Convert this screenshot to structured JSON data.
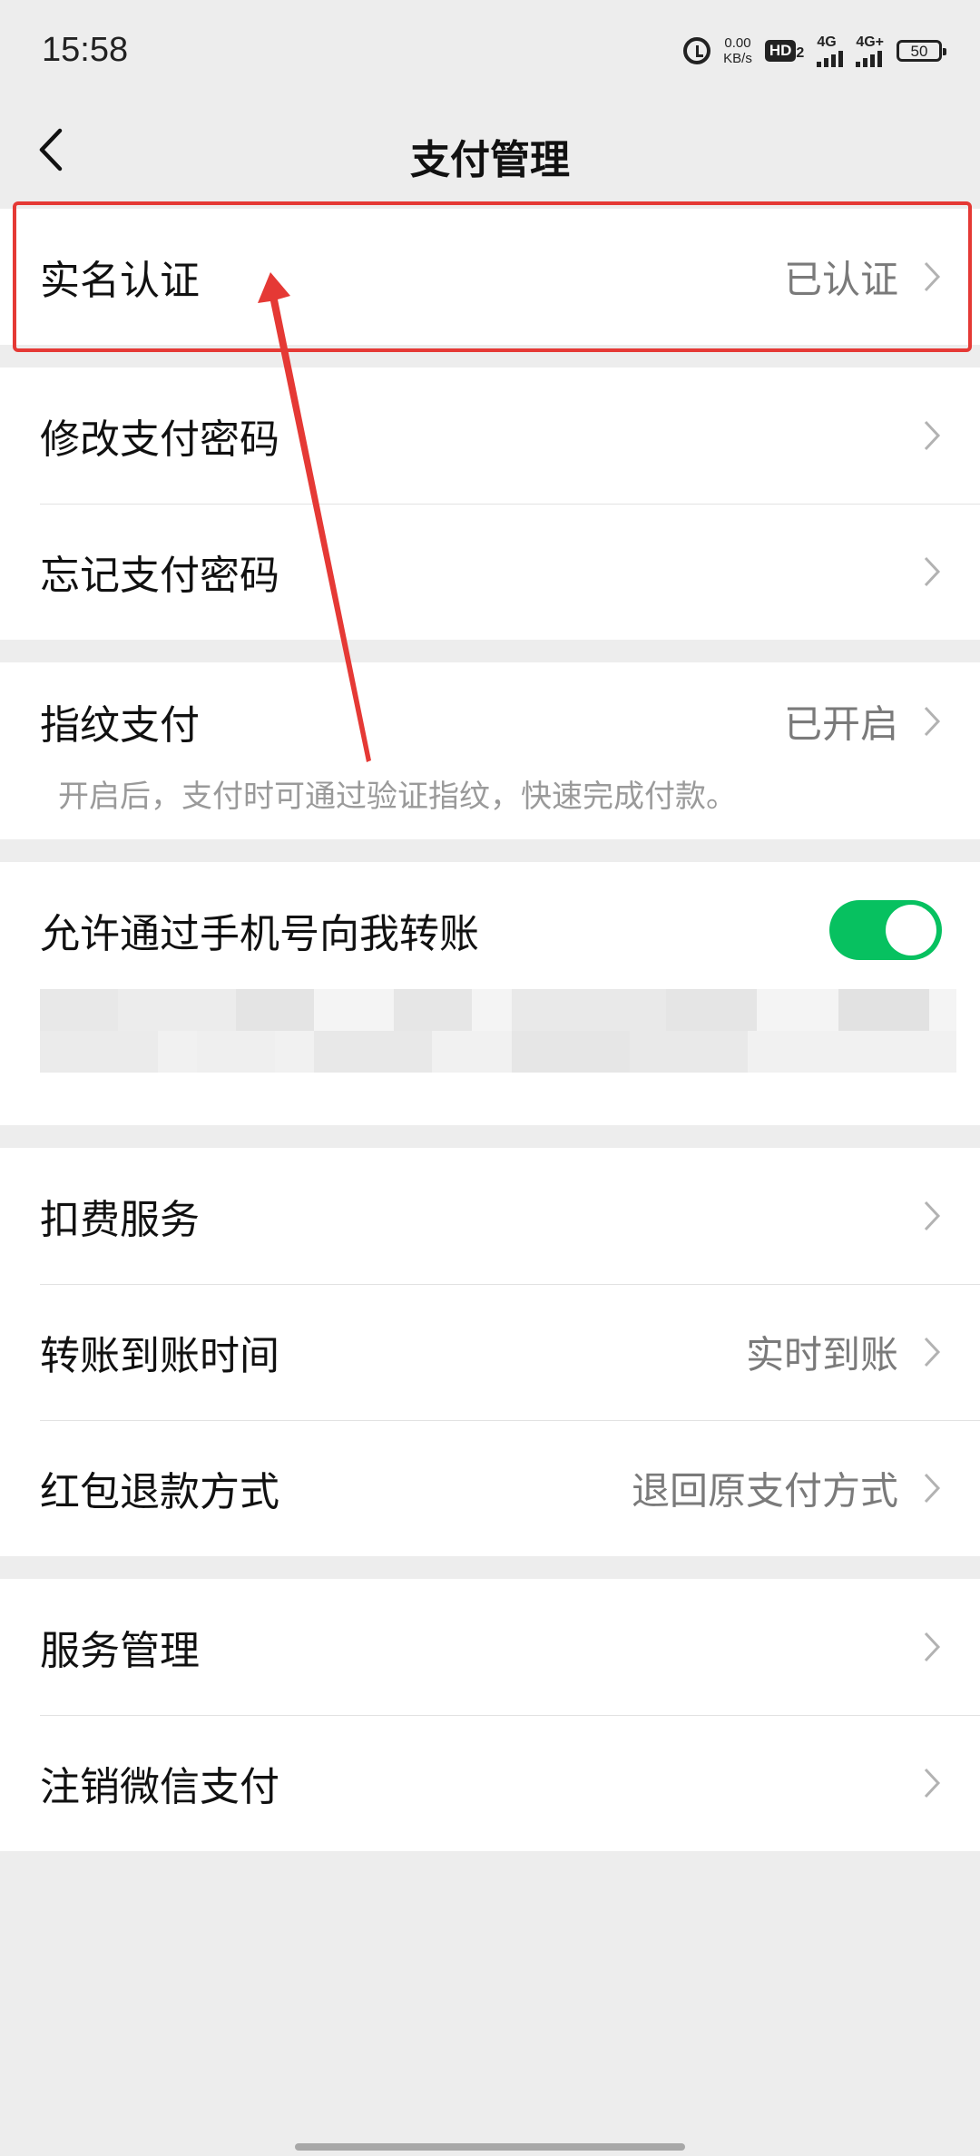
{
  "status_bar": {
    "time": "15:58",
    "net_speed_value": "0.00",
    "net_speed_unit": "KB/s",
    "hd_label": "HD",
    "hd_sub": "2",
    "sim1_label": "4G",
    "sim2_label": "4G+",
    "battery": "50"
  },
  "header": {
    "title": "支付管理"
  },
  "sections": {
    "real_name": {
      "label": "实名认证",
      "value": "已认证"
    },
    "change_pwd": {
      "label": "修改支付密码"
    },
    "forgot_pwd": {
      "label": "忘记支付密码"
    },
    "fingerprint": {
      "label": "指纹支付",
      "value": "已开启",
      "desc": "开启后，支付时可通过验证指纹，快速完成付款。"
    },
    "phone_transfer": {
      "label": "允许通过手机号向我转账",
      "enabled": true
    },
    "deduction": {
      "label": "扣费服务"
    },
    "transfer_time": {
      "label": "转账到账时间",
      "value": "实时到账"
    },
    "redpacket_refund": {
      "label": "红包退款方式",
      "value": "退回原支付方式"
    },
    "service_mgmt": {
      "label": "服务管理"
    },
    "cancel_pay": {
      "label": "注销微信支付"
    }
  },
  "colors": {
    "accent": "#07c160",
    "highlight": "#e53935",
    "background": "#ededed"
  }
}
